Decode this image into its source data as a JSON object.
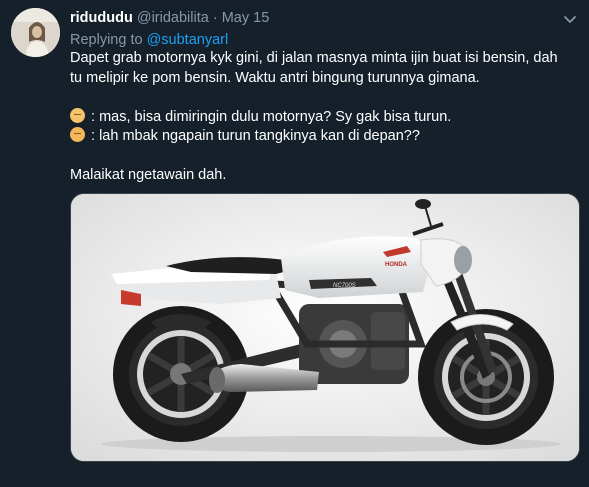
{
  "tweet": {
    "display_name": "ridududu",
    "handle": "@iridabilita",
    "separator": "·",
    "date": "May 15",
    "replying_prefix": "Replying to",
    "replying_to": "@subtanyarl",
    "text_lines": [
      "Dapet grab motornya kyk gini, di jalan masnya minta ijin buat isi bensin, dah",
      "tu melipir ke pom bensin. Waktu antri bingung turunnya gimana."
    ],
    "dialog_1": ": mas, bisa dimiringin dulu motornya? Sy gak bisa turun.",
    "dialog_2": ": lah mbak ngapain turun tangkinya kan di depan??",
    "closing": "Malaikat ngetawain dah."
  },
  "icons": {
    "more": "chevron-down-icon",
    "emoji_1": "woman-emoji-icon",
    "emoji_2": "man-emoji-icon"
  },
  "media": {
    "subject": "white motorcycle photo",
    "bike_brand_mark": "HONDA"
  },
  "colors": {
    "background": "#15202b",
    "text": "#ffffff",
    "muted": "#8899a6",
    "link": "#1da1f2",
    "border": "#38444d"
  }
}
